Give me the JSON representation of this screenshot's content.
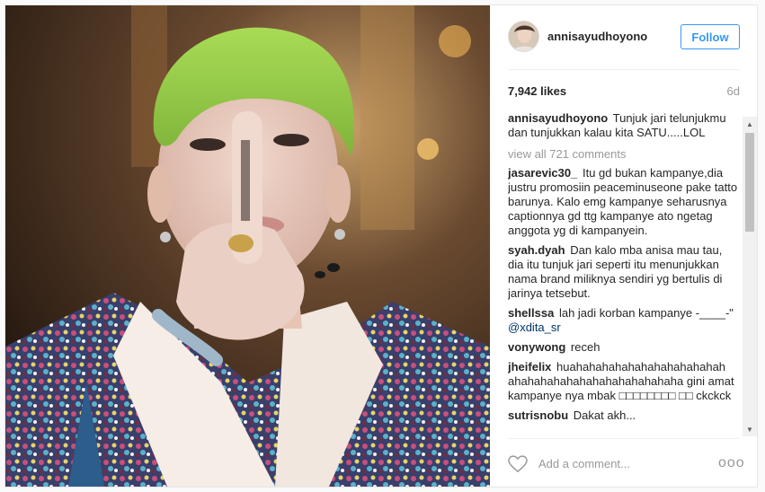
{
  "post": {
    "username": "annisayudhoyono",
    "follow_label": "Follow",
    "likes": "7,942 likes",
    "age": "6d",
    "caption": {
      "author": "annisayudhoyono",
      "text": "Tunjuk jari telunjukmu dan tunjukkan kalau kita SATU.....LOL"
    },
    "view_all": "view all 721 comments",
    "comments": [
      {
        "author": "jasarevic30_",
        "text": "Itu gd bukan kampanye,dia justru promosiin peaceminuseone pake tatto barunya. Kalo emg kampanye seharusnya captionnya gd ttg kampanye ato ngetag anggota yg di kampanyein."
      },
      {
        "author": "syah.dyah",
        "text": "Dan kalo mba anisa mau tau, dia itu tunjuk jari seperti itu menunjukkan nama brand miliknya sendiri yg bertulis di jarinya tetsebut."
      },
      {
        "author": "shellssa",
        "text": "lah jadi korban kampanye -____-\"",
        "mention": "@xdita_sr"
      },
      {
        "author": "vonywong",
        "text": "receh"
      },
      {
        "author": "jheifelix",
        "text": "huahahahahahahahahahahahah ahahahahahahahahahahahahaha gini amat kampanye nya mbak □□□□□□□□ □□ ckckck"
      },
      {
        "author": "sutrisnobu",
        "text": "Dakat akh..."
      }
    ],
    "add_comment_placeholder": "Add a comment...",
    "more_label": "ooo"
  },
  "icons": {
    "heart": "heart-icon",
    "more": "more-options-icon",
    "scroll_up": "scroll-up-arrow-icon",
    "scroll_down": "scroll-down-arrow-icon"
  },
  "colors": {
    "accent": "#3897f0",
    "text": "#262626",
    "muted": "#999999",
    "hair": "#9bd34a"
  }
}
